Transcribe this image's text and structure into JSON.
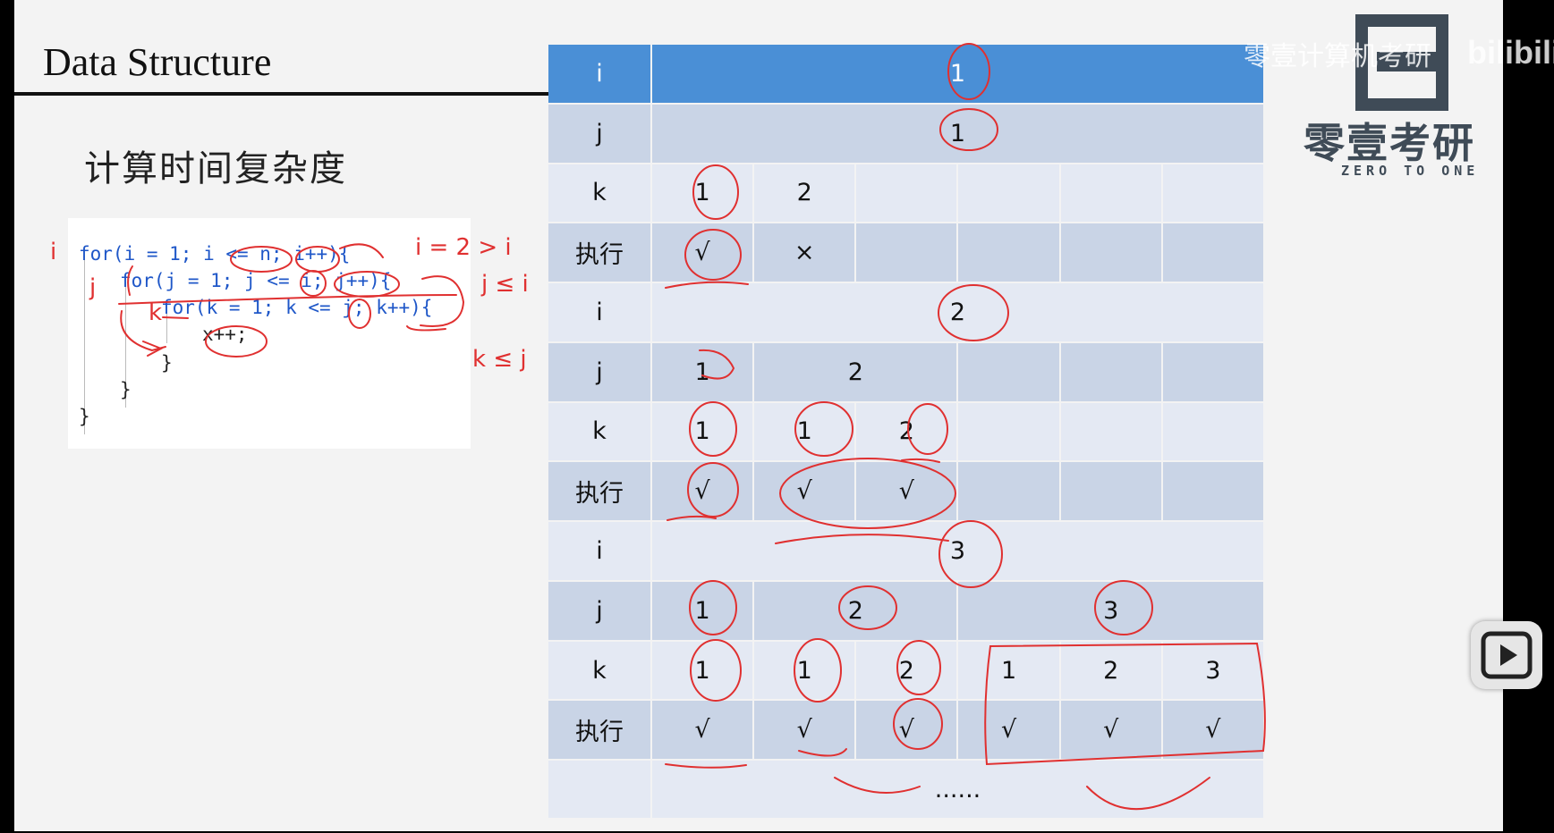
{
  "slide": {
    "title": "Data Structure",
    "subtitle": "计算时间复杂度"
  },
  "code": {
    "lines": [
      "for(i = 1; i <= n; i++){",
      "for(j = 1; j <= i; j++){",
      "for(k = 1; k <= j; k++){",
      "x++;",
      "}",
      "}",
      "}"
    ]
  },
  "table": {
    "rows": [
      {
        "label": "i",
        "cells": [
          "1"
        ]
      },
      {
        "label": "j",
        "cells": [
          "1"
        ]
      },
      {
        "label": "k",
        "cells": [
          "1",
          "2",
          "",
          "",
          "",
          ""
        ]
      },
      {
        "label": "执行",
        "cells": [
          "√",
          "×",
          "",
          "",
          "",
          ""
        ]
      },
      {
        "label": "i",
        "cells": [
          "2"
        ]
      },
      {
        "label": "j",
        "cells": [
          "1",
          "2",
          "",
          "",
          ""
        ]
      },
      {
        "label": "k",
        "cells": [
          "1",
          "1",
          "2",
          "",
          "",
          ""
        ]
      },
      {
        "label": "执行",
        "cells": [
          "√",
          "√",
          "√",
          "",
          "",
          ""
        ]
      },
      {
        "label": "i",
        "cells": [
          "3"
        ]
      },
      {
        "label": "j",
        "cells": [
          "1",
          "2",
          "3"
        ]
      },
      {
        "label": "k",
        "cells": [
          "1",
          "1",
          "2",
          "1",
          "2",
          "3"
        ]
      },
      {
        "label": "执行",
        "cells": [
          "√",
          "√",
          "√",
          "√",
          "√",
          "√"
        ]
      },
      {
        "label": "",
        "cells": [
          "......"
        ]
      }
    ]
  },
  "handwriting": {
    "i_mark": "i",
    "j_mark": "j",
    "k_mark": "k",
    "i_cond": "i = 2 > i",
    "j_cond": "j ≤ i",
    "k_cond": "k ≤ j"
  },
  "logo": {
    "cn": "零壹考研",
    "en": "ZERO TO ONE"
  },
  "watermark": {
    "text": "零壹计算机考研",
    "brand": "bilibili"
  },
  "colors": {
    "header_blue": "#4a8fd6",
    "row_dark": "#c9d4e6",
    "row_light": "#e4e9f3",
    "ink_red": "#e03030"
  }
}
